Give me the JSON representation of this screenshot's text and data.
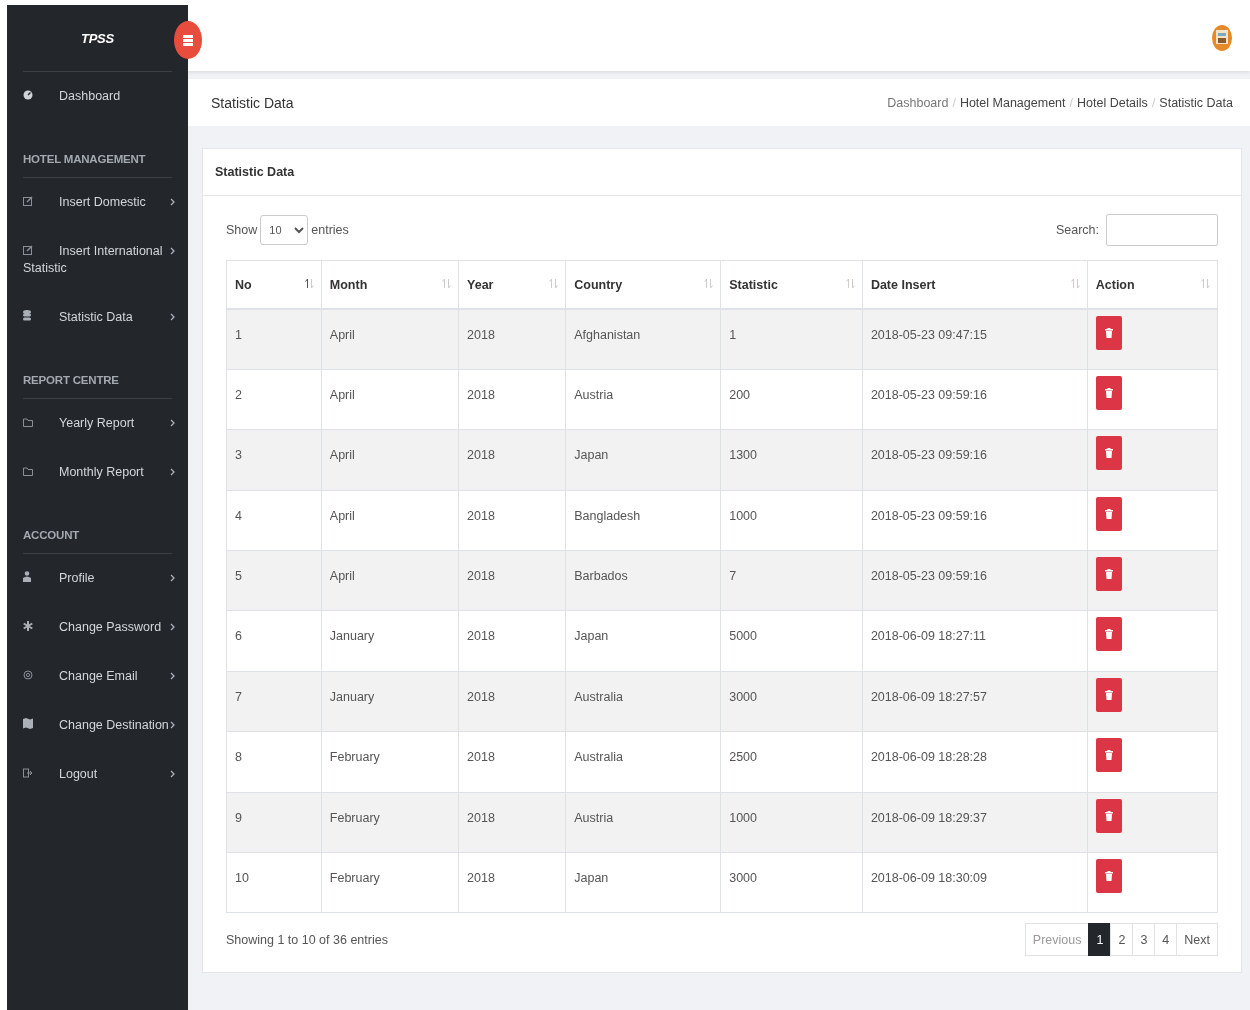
{
  "sidebar": {
    "brand": "TPSS",
    "top_items": [
      {
        "label": "Dashboard"
      }
    ],
    "sections": [
      {
        "heading": "HOTEL MANAGEMENT",
        "items": [
          {
            "label": "Insert Domestic"
          },
          {
            "label": "Insert International Statistic"
          },
          {
            "label": "Statistic Data"
          }
        ]
      },
      {
        "heading": "REPORT CENTRE",
        "items": [
          {
            "label": "Yearly Report"
          },
          {
            "label": "Monthly Report"
          }
        ]
      },
      {
        "heading": "ACCOUNT",
        "items": [
          {
            "label": "Profile"
          },
          {
            "label": "Change Password"
          },
          {
            "label": "Change Email"
          },
          {
            "label": "Change Destination"
          },
          {
            "label": "Logout"
          }
        ]
      }
    ]
  },
  "page_header": {
    "title": "Statistic Data",
    "breadcrumb_separator": "/",
    "breadcrumb": [
      "Dashboard",
      "Hotel Management",
      "Hotel Details",
      "Statistic Data"
    ]
  },
  "card": {
    "title": "Statistic Data",
    "length_menu": {
      "before": "Show",
      "value": "10",
      "after": "entries"
    },
    "search": {
      "label": "Search:"
    },
    "table": {
      "columns": [
        {
          "label": "No",
          "sorted": true
        },
        {
          "label": "Month",
          "sorted": false
        },
        {
          "label": "Year",
          "sorted": false
        },
        {
          "label": "Country",
          "sorted": false
        },
        {
          "label": "Statistic",
          "sorted": false
        },
        {
          "label": "Date Insert",
          "sorted": false
        },
        {
          "label": "Action",
          "sorted": false
        }
      ],
      "rows": [
        [
          "1",
          "April",
          "2018",
          "Afghanistan",
          "1",
          "2018-05-23 09:47:15"
        ],
        [
          "2",
          "April",
          "2018",
          "Austria",
          "200",
          "2018-05-23 09:59:16"
        ],
        [
          "3",
          "April",
          "2018",
          "Japan",
          "1300",
          "2018-05-23 09:59:16"
        ],
        [
          "4",
          "April",
          "2018",
          "Bangladesh",
          "1000",
          "2018-05-23 09:59:16"
        ],
        [
          "5",
          "April",
          "2018",
          "Barbados",
          "7",
          "2018-05-23 09:59:16"
        ],
        [
          "6",
          "January",
          "2018",
          "Japan",
          "5000",
          "2018-06-09 18:27:11"
        ],
        [
          "7",
          "January",
          "2018",
          "Australia",
          "3000",
          "2018-06-09 18:27:57"
        ],
        [
          "8",
          "February",
          "2018",
          "Australia",
          "2500",
          "2018-06-09 18:28:28"
        ],
        [
          "9",
          "February",
          "2018",
          "Austria",
          "1000",
          "2018-06-09 18:29:37"
        ],
        [
          "10",
          "February",
          "2018",
          "Japan",
          "3000",
          "2018-06-09 18:30:09"
        ]
      ]
    },
    "info": "Showing 1 to 10 of 36 entries",
    "pagination": {
      "previous": "Previous",
      "pages": [
        {
          "label": "1",
          "selected": true
        },
        {
          "label": "2",
          "selected": false
        },
        {
          "label": "3",
          "selected": false
        },
        {
          "label": "4",
          "selected": false
        }
      ],
      "next": "Next"
    }
  }
}
